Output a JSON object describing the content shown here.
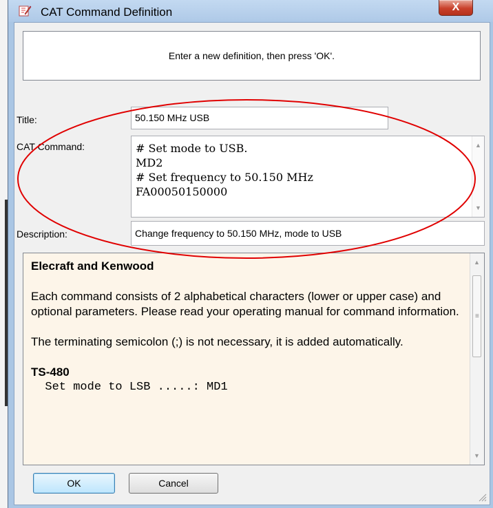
{
  "window": {
    "title": "CAT Command Definition",
    "close_glyph": "X"
  },
  "banner": {
    "text": "Enter a new definition, then press 'OK'."
  },
  "form": {
    "title_label": "Title:",
    "title_value": "50.150 MHz USB",
    "cat_label": "CAT Command:",
    "cat_lines": [
      "# Set mode to USB.",
      "MD2",
      "# Set frequency to 50.150 MHz",
      "FA00050150000"
    ],
    "description_label": "Description:",
    "description_value": "Change frequency to 50.150 MHz, mode to USB"
  },
  "help": {
    "heading": "Elecraft and Kenwood",
    "paragraph1": "Each command consists of 2 alphabetical characters (lower or upper case) and optional parameters. Please read your operating manual for command information.",
    "paragraph2": "The terminating semicolon (;) is not necessary, it is added automatically.",
    "model_heading": "TS-480",
    "example_line": "  Set mode to LSB .....: MD1"
  },
  "buttons": {
    "ok_label": "OK",
    "cancel_label": "Cancel"
  },
  "colors": {
    "annotation_circle": "#e00000",
    "help_background": "#fdf5e9",
    "titlebar": "#aec9e7"
  },
  "icons": {
    "app": "edit-pencil-icon",
    "close": "close-icon",
    "scroll_up": "up-arrow-icon",
    "scroll_down": "down-arrow-icon",
    "resize": "resize-grip-icon"
  }
}
